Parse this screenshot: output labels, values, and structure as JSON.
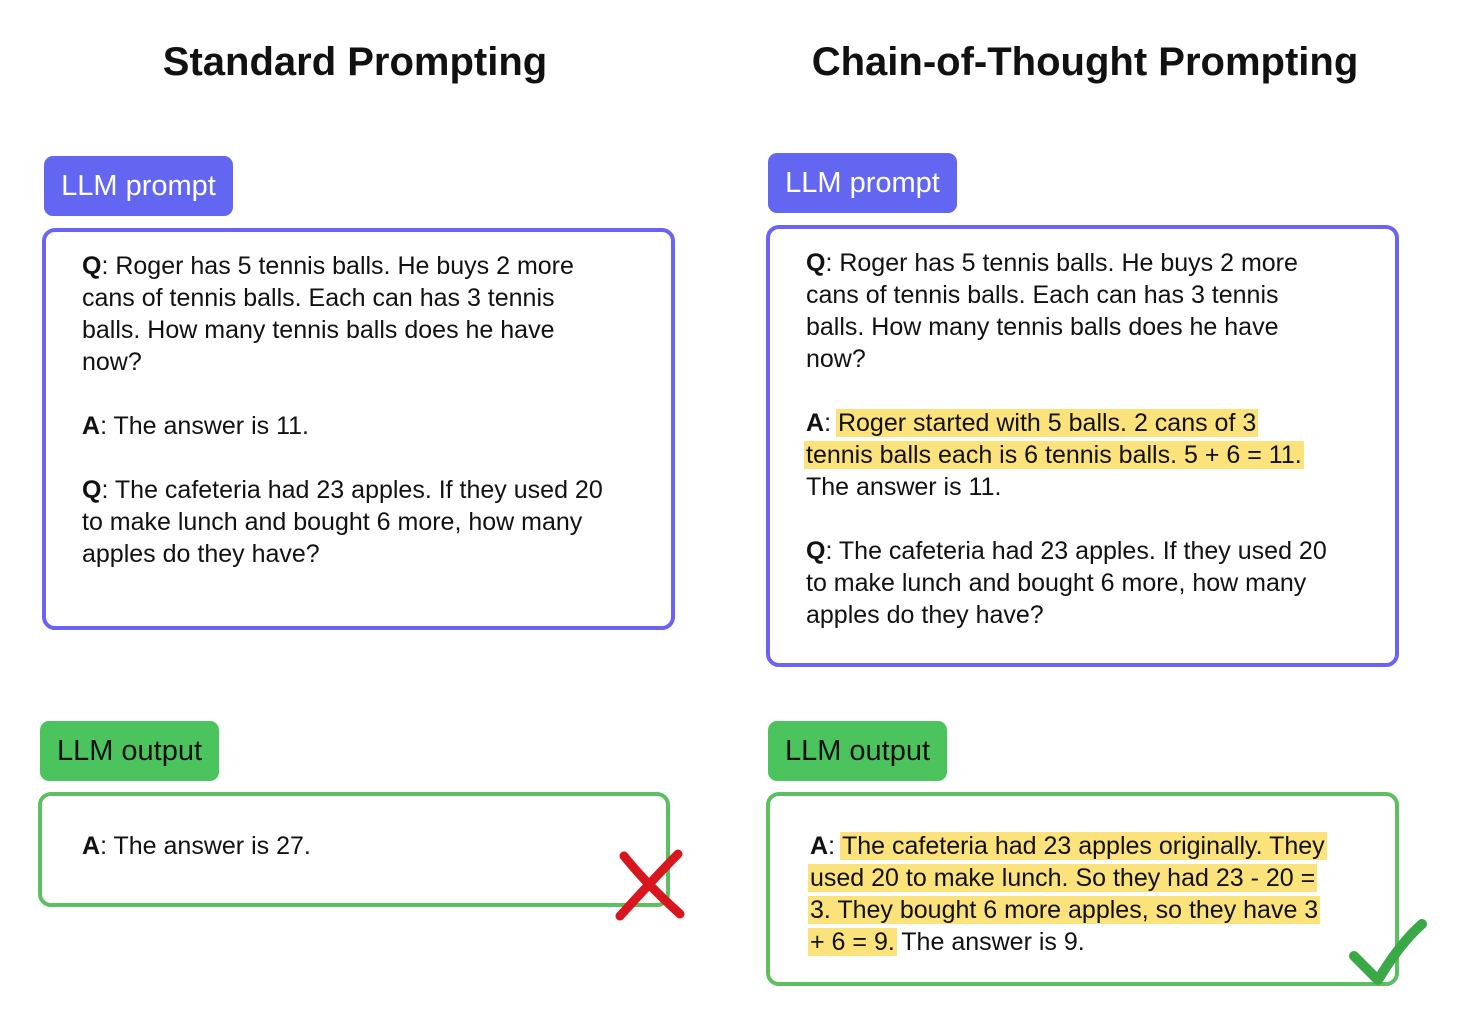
{
  "left": {
    "heading": "Standard Prompting",
    "prompt_label": "LLM prompt",
    "output_label": "LLM output",
    "q1_key": "Q",
    "q1_lines": [
      ": Roger has 5 tennis balls. He buys 2 more",
      "cans of tennis balls. Each can has 3 tennis",
      "balls. How many tennis balls does he have",
      "now?"
    ],
    "a1_key": "A",
    "a1_text": ": The answer is 11.",
    "q2_key": "Q",
    "q2_lines": [
      ": The cafeteria had 23 apples. If they used 20",
      "to make lunch and bought 6 more, how many",
      "apples do they have?"
    ],
    "out_key": "A",
    "out_text": ": The answer is 27.",
    "result_icon": "red-x-icon"
  },
  "right": {
    "heading": "Chain-of-Thought Prompting",
    "prompt_label": "LLM prompt",
    "output_label": "LLM output",
    "q1_key": "Q",
    "q1_lines": [
      ": Roger has 5 tennis balls. He buys 2 more",
      "cans of tennis balls. Each can has 3 tennis",
      "balls. How many tennis balls does he have",
      "now?"
    ],
    "a1_key": "A",
    "a1_sep": ": ",
    "a1_hl_1": "Roger started with 5 balls. 2 cans of 3",
    "a1_hl_2": "tennis balls each is 6 tennis balls. 5 + 6 = 11.",
    "a1_line3": "The answer is 11.",
    "q2_key": "Q",
    "q2_lines": [
      ": The cafeteria had 23 apples. If they used 20",
      "to make lunch and bought 6 more, how many",
      "apples do they have?"
    ],
    "out_key": "A",
    "out_sep": ": ",
    "out_hl_1": "The cafeteria had 23 apples originally. They",
    "out_hl_2": "used 20 to make lunch. So they had 23 - 20 =",
    "out_hl_3": "3. They bought 6 more apples, so they have 3",
    "out_hl_4": "+ 6 = 9.",
    "out_tail": " The answer is 9.",
    "result_icon": "green-check-icon"
  },
  "colors": {
    "prompt_accent": "#6366f1",
    "output_accent": "#4cc45e",
    "highlight": "#fbe27a",
    "wrong": "#d8161d",
    "correct": "#3aa846"
  }
}
